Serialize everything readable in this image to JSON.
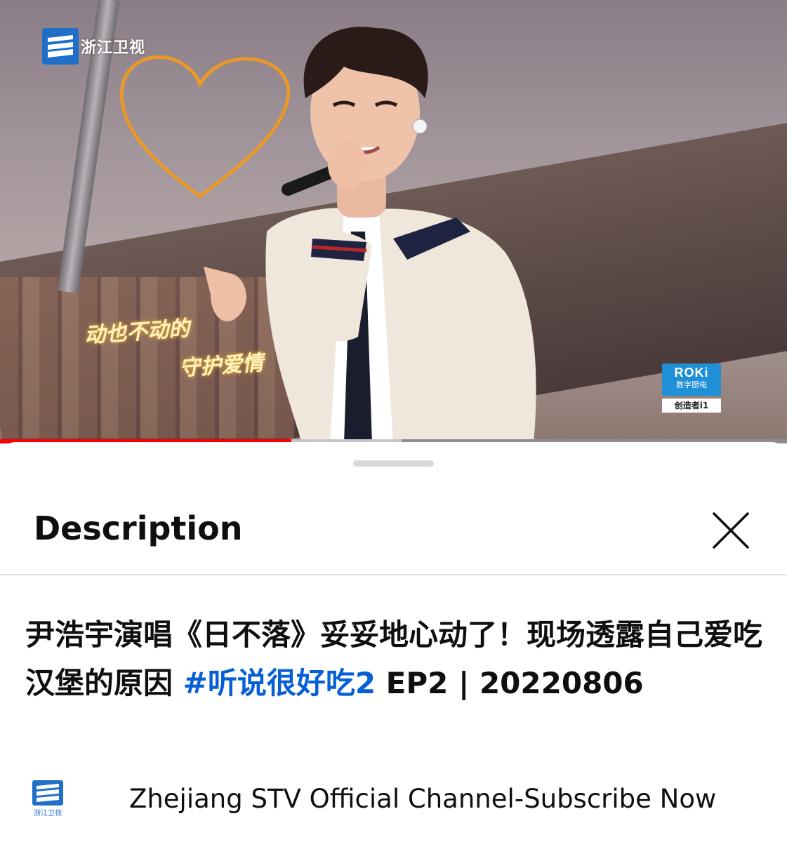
{
  "video": {
    "broadcaster_logo_text": "浙江卫视",
    "lyric_line1": "动也不动的",
    "lyric_line2": "守护爱情",
    "sponsor_brand": "ROKi",
    "sponsor_sub": "数字厨电",
    "sponsor_model": "创造者i1",
    "progress_played": 0.37,
    "progress_buffered": 0.51
  },
  "sheet": {
    "header": "Description",
    "title_main": "尹浩宇演唱《日不落》妥妥地心动了！现场透露自己爱吃汉堡的原因 ",
    "title_hashtag": "#听说很好吃2",
    "title_tail": " EP2 | 20220806",
    "channel_name": "Zhejiang STV Official Channel-Subscribe Now",
    "channel_logo_text": "浙江卫视"
  },
  "colors": {
    "progress": "#ff0000",
    "hashtag": "#065fd4",
    "text": "#0f0f0f",
    "logo_blue": "#1f6fc9"
  },
  "icons": [
    "zhejiang-tv-logo-icon",
    "heart-drawing-icon",
    "close-icon",
    "channel-avatar-icon"
  ]
}
